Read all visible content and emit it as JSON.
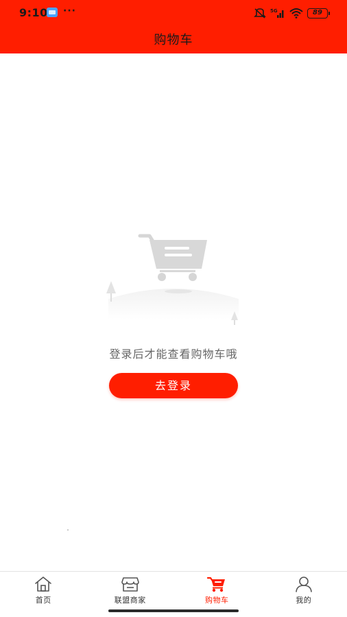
{
  "status_bar": {
    "time": "9:10",
    "dots": "···",
    "battery": "89",
    "network": "5G"
  },
  "header": {
    "title": "购物车"
  },
  "empty_state": {
    "message": "登录后才能查看购物车哦",
    "login_button": "去登录",
    "illustration": "cart-illustration-icon"
  },
  "tabs": [
    {
      "label": "首页",
      "icon": "home-icon",
      "active": false
    },
    {
      "label": "联盟商家",
      "icon": "store-icon",
      "active": false
    },
    {
      "label": "购物车",
      "icon": "cart-icon",
      "active": true
    },
    {
      "label": "我的",
      "icon": "user-icon",
      "active": false
    }
  ],
  "colors": {
    "brand_red": "#ff1e00",
    "text_muted": "#666666",
    "tab_text": "#333333"
  }
}
